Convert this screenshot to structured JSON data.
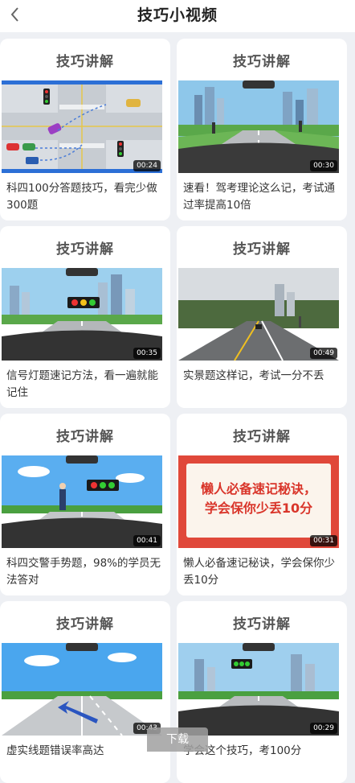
{
  "header": {
    "title": "技巧小视频",
    "back_icon": "chevron-left-icon"
  },
  "cards": [
    {
      "heading": "技巧讲解",
      "duration": "00:24",
      "description": "科四100分答题技巧，看完少做300题"
    },
    {
      "heading": "技巧讲解",
      "duration": "00:30",
      "description": "速看！驾考理论这么记，考试通过率提高10倍"
    },
    {
      "heading": "技巧讲解",
      "duration": "00:35",
      "description": "信号灯题速记方法，看一遍就能记住"
    },
    {
      "heading": "技巧讲解",
      "duration": "00:49",
      "description": "实景题这样记，考试一分不丢"
    },
    {
      "heading": "技巧讲解",
      "duration": "00:41",
      "description": "科四交警手势题，98%的学员无法答对"
    },
    {
      "heading": "技巧讲解",
      "duration": "00:31",
      "description": "懒人必备速记秘诀，学会保你少丢10分",
      "poster_line1": "懒人必备速记秘诀，",
      "poster_line2": "学会保你少丢10分"
    },
    {
      "heading": "技巧讲解",
      "duration": "00:43",
      "description": "虚实线题错误率高达"
    },
    {
      "heading": "技巧讲解",
      "duration": "00:29",
      "description": "学会这个技巧，考100分"
    }
  ],
  "download_label": "下载",
  "colors": {
    "background": "#eef0f4",
    "card": "#ffffff",
    "poster_red": "#e0483a"
  }
}
